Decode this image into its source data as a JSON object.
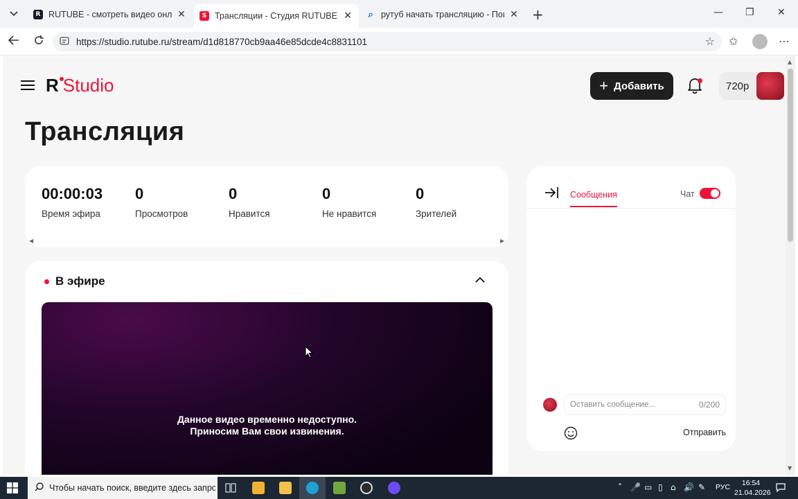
{
  "browser": {
    "tabs": [
      {
        "title": "RUTUBE - смотреть видео онлайн",
        "favicon_color": "#1a1a2e",
        "active": false
      },
      {
        "title": "Трансляции - Студия RUTUBE",
        "favicon_color": "#ed143b",
        "active": true
      },
      {
        "title": "рутуб начать трансляцию - Поиск",
        "favicon_color": "#1a73e8",
        "active": false
      }
    ],
    "url": "https://studio.rutube.ru/stream/d1d818770cb9aa46e85dcde4c8831101"
  },
  "header": {
    "logo_r": "R",
    "logo_studio": "Studio",
    "add_label": "Добавить",
    "balance": "720р"
  },
  "page": {
    "title": "Трансляция"
  },
  "stats": [
    {
      "value": "00:00:03",
      "label": "Время эфира"
    },
    {
      "value": "0",
      "label": "Просмотров"
    },
    {
      "value": "0",
      "label": "Нравится"
    },
    {
      "value": "0",
      "label": "Не нравится"
    },
    {
      "value": "0",
      "label": "Зрителей"
    }
  ],
  "live": {
    "heading": "В эфире",
    "player_message_line1": "Данное видео временно недоступно.",
    "player_message_line2": "Приносим Вам свои извинения."
  },
  "chat": {
    "tab_messages": "Сообщения",
    "chat_label": "Чат",
    "chat_enabled": true,
    "input_placeholder": "Оставить сообщение...",
    "char_count": "0/200",
    "send_label": "Отправить"
  },
  "taskbar": {
    "search_placeholder": "Чтобы начать поиск, введите здесь запрос",
    "lang": "РУС",
    "time": "16:54",
    "date": "21.04.2026"
  },
  "colors": {
    "accent": "#ed143b",
    "dark": "#1f1f1f"
  }
}
